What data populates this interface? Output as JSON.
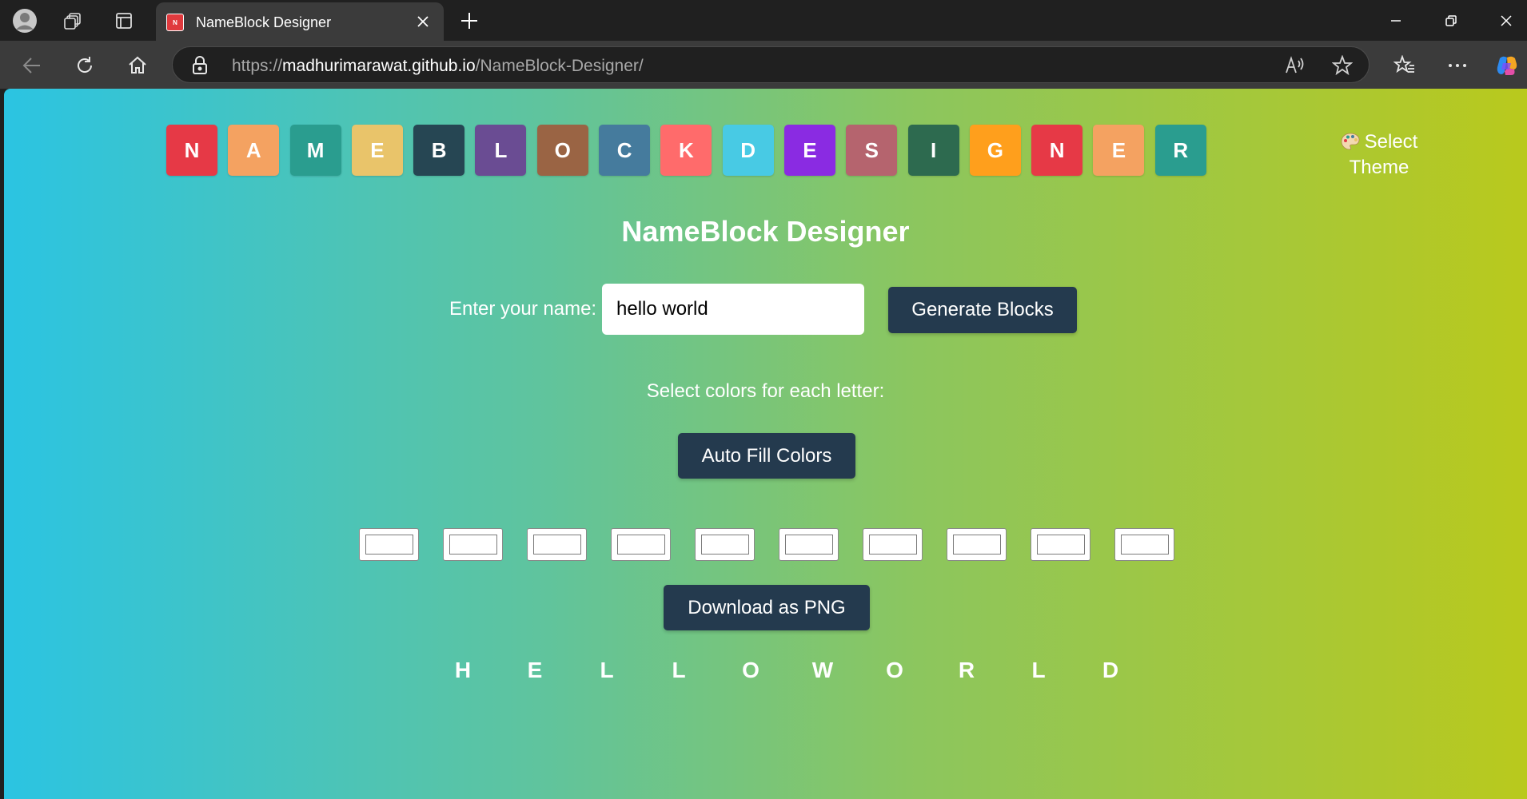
{
  "browser": {
    "tab_title": "NameBlock Designer",
    "favicon_letter": "N",
    "url_scheme": "https://",
    "url_host": "madhurimarawat.github.io",
    "url_path": "/NameBlock-Designer/"
  },
  "page": {
    "header_letters": [
      {
        "letter": "N",
        "color": "#e63946"
      },
      {
        "letter": "A",
        "color": "#f4a261"
      },
      {
        "letter": "M",
        "color": "#2a9d8f"
      },
      {
        "letter": "E",
        "color": "#e9c46a"
      },
      {
        "letter": "B",
        "color": "#264653"
      },
      {
        "letter": "L",
        "color": "#6a4c93"
      },
      {
        "letter": "O",
        "color": "#9a6444"
      },
      {
        "letter": "C",
        "color": "#457b9d"
      },
      {
        "letter": "K",
        "color": "#ff6b6b"
      },
      {
        "letter": "D",
        "color": "#48cae4"
      },
      {
        "letter": "E",
        "color": "#8a2be2"
      },
      {
        "letter": "S",
        "color": "#b5646e"
      },
      {
        "letter": "I",
        "color": "#2d6a4f"
      },
      {
        "letter": "G",
        "color": "#ff9f1c"
      },
      {
        "letter": "N",
        "color": "#e63946"
      },
      {
        "letter": "E",
        "color": "#f4a261"
      },
      {
        "letter": "R",
        "color": "#2a9d8f"
      }
    ],
    "theme_label": "Select Theme",
    "title": "NameBlock Designer",
    "name_label": "Enter your name:",
    "name_value": "hello world",
    "generate_button": "Generate Blocks",
    "select_colors_label": "Select colors for each letter:",
    "auto_fill_button": "Auto Fill Colors",
    "color_inputs": [
      "#ffffff",
      "#ffffff",
      "#ffffff",
      "#ffffff",
      "#ffffff",
      "#ffffff",
      "#ffffff",
      "#ffffff",
      "#ffffff",
      "#ffffff"
    ],
    "download_button": "Download as PNG",
    "preview_letters": [
      "H",
      "E",
      "L",
      "L",
      "O",
      "W",
      "O",
      "R",
      "L",
      "D"
    ]
  },
  "colors": {
    "button_bg": "#243a4e",
    "gradient_start": "#2bc4e2",
    "gradient_end": "#b9c91d"
  }
}
